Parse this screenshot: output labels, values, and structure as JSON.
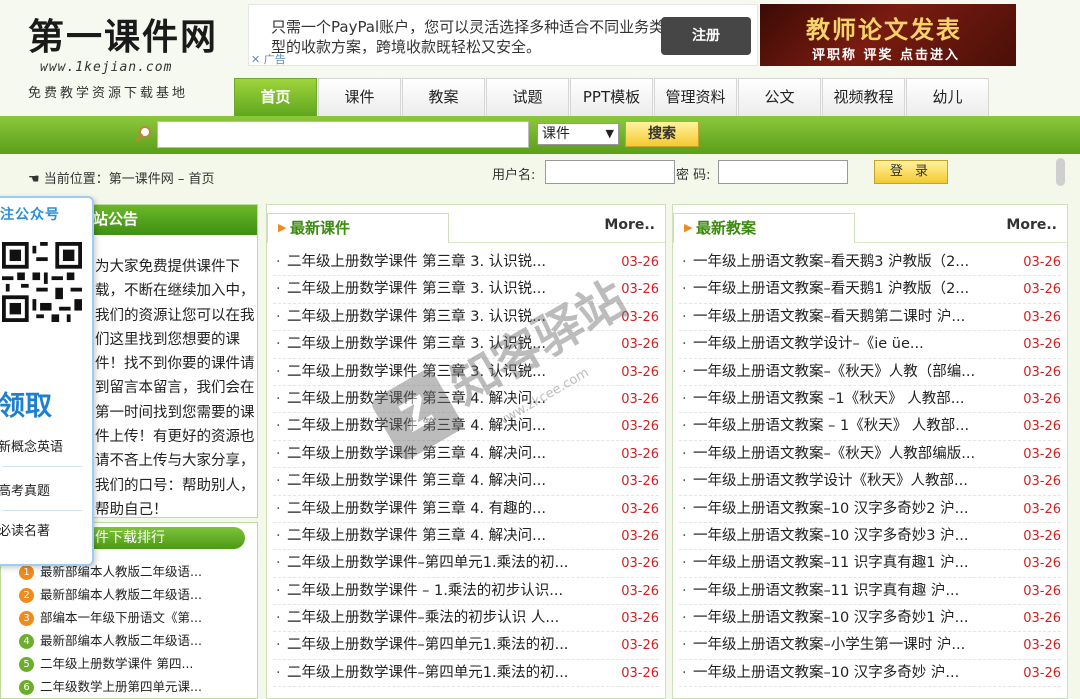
{
  "site": {
    "logo_text": "第一课件网",
    "logo_url": "www.1kejian.com",
    "slogan": "免费教学资源下载基地"
  },
  "ads": {
    "paypal": {
      "text": "只需一个PayPal账户，您可以灵活选择多种适合不同业务类型的收款方案，跨境收款既轻松又安全。",
      "button": "注册",
      "mark": "广告"
    },
    "teacher": {
      "title": "教师论文发表",
      "subtitle": "评职称 评奖 点击进入"
    }
  },
  "nav": {
    "items": [
      "首页",
      "课件",
      "教案",
      "试题",
      "PPT模板",
      "管理资料",
      "公文",
      "视频教程",
      "幼儿"
    ],
    "active": 0
  },
  "search": {
    "placeholder": "",
    "category": "课件",
    "button": "搜索"
  },
  "breadcrumb": "当前位置：第一课件网 – 首页",
  "login": {
    "username_label": "用户名:",
    "password_label": "密 码:",
    "button": "登 录"
  },
  "notice": {
    "title": "站公告",
    "text": "为大家免费提供课件下载，不断在继续加入中，我们的资源让您可以在我们这里找到您想要的课件！找不到你要的课件请到留言本留言，我们会在第一时间找到您需要的课件上传！有更好的资源也请不吝上传与大家分享，我们的口号：帮助别人，帮助自己！"
  },
  "qr_widget": {
    "title": "注公众号",
    "claim": "领取",
    "links": [
      "新概念英语",
      "高考真题",
      "必读名著"
    ]
  },
  "rank": {
    "title": "件下载排行",
    "items": [
      {
        "num": "1",
        "color": "#f08a1c",
        "text": "最新部编本人教版二年级语..."
      },
      {
        "num": "2",
        "color": "#f08a1c",
        "text": "最新部编本人教版二年级语..."
      },
      {
        "num": "3",
        "color": "#f08a1c",
        "text": "部编本一年级下册语文《第..."
      },
      {
        "num": "4",
        "color": "#6aae2a",
        "text": "最新部编本人教版二年级语..."
      },
      {
        "num": "5",
        "color": "#6aae2a",
        "text": "二年级上册数学课件 第四..."
      },
      {
        "num": "6",
        "color": "#6aae2a",
        "text": "二年级数学上册第四单元课..."
      }
    ]
  },
  "panels": {
    "kejian": {
      "title": "最新课件",
      "more": "More..",
      "rows": [
        {
          "title": "二年级上册数学课件 第三章 3. 认识锐...",
          "date": "03-26"
        },
        {
          "title": "二年级上册数学课件 第三章 3. 认识锐...",
          "date": "03-26"
        },
        {
          "title": "二年级上册数学课件 第三章 3. 认识锐...",
          "date": "03-26"
        },
        {
          "title": "二年级上册数学课件 第三章 3. 认识锐...",
          "date": "03-26"
        },
        {
          "title": "二年级上册数学课件 第三章 3. 认识锐...",
          "date": "03-26"
        },
        {
          "title": "二年级上册数学课件 第三章 4. 解决问...",
          "date": "03-26"
        },
        {
          "title": "二年级上册数学课件 第三章 4. 解决问...",
          "date": "03-26"
        },
        {
          "title": "二年级上册数学课件 第三章 4. 解决问...",
          "date": "03-26"
        },
        {
          "title": "二年级上册数学课件 第三章 4. 解决问...",
          "date": "03-26"
        },
        {
          "title": "二年级上册数学课件 第三章 4. 有趣的...",
          "date": "03-26"
        },
        {
          "title": "二年级上册数学课件 第三章 4. 解决问...",
          "date": "03-26"
        },
        {
          "title": "二年级上册数学课件–第四单元1.乘法的初...",
          "date": "03-26"
        },
        {
          "title": "二年级上册数学课件 – 1.乘法的初步认识...",
          "date": "03-26"
        },
        {
          "title": "二年级上册数学课件–乘法的初步认识 人...",
          "date": "03-26"
        },
        {
          "title": "二年级上册数学课件–第四单元1.乘法的初...",
          "date": "03-26"
        },
        {
          "title": "二年级上册数学课件–第四单元1.乘法的初...",
          "date": "03-26"
        }
      ]
    },
    "jiaoan": {
      "title": "最新教案",
      "more": "More..",
      "rows": [
        {
          "title": "一年级上册语文教案–看天鹅3 沪教版（2...",
          "date": "03-26"
        },
        {
          "title": "一年级上册语文教案–看天鹅1 沪教版（2...",
          "date": "03-26"
        },
        {
          "title": "一年级上册语文教案–看天鹅第二课时 沪...",
          "date": "03-26"
        },
        {
          "title": "一年级上册语文教学设计–《ie üe...",
          "date": "03-26"
        },
        {
          "title": "一年级上册语文教案–《秋天》人教（部编...",
          "date": "03-26"
        },
        {
          "title": "一年级上册语文教案 –1《秋天》 人教部...",
          "date": "03-26"
        },
        {
          "title": "一年级上册语文教案 – 1《秋天》 人教部...",
          "date": "03-26"
        },
        {
          "title": "一年级上册语文教案–《秋天》人教部编版...",
          "date": "03-26"
        },
        {
          "title": "一年级上册语文教学设计《秋天》人教部...",
          "date": "03-26"
        },
        {
          "title": "一年级上册语文教案–10 汉字多奇妙2 沪...",
          "date": "03-26"
        },
        {
          "title": "一年级上册语文教案–10 汉字多奇妙3 沪...",
          "date": "03-26"
        },
        {
          "title": "一年级上册语文教案–11 识字真有趣1 沪...",
          "date": "03-26"
        },
        {
          "title": "一年级上册语文教案–11 识字真有趣 沪...",
          "date": "03-26"
        },
        {
          "title": "一年级上册语文教案–10 汉字多奇妙1 沪...",
          "date": "03-26"
        },
        {
          "title": "一年级上册语文教案–小学生第一课时 沪...",
          "date": "03-26"
        },
        {
          "title": "一年级上册语文教案–10 汉字多奇妙 沪...",
          "date": "03-26"
        }
      ]
    }
  },
  "watermark": {
    "text": "知客驿站",
    "domain": "www.zkcee.com"
  }
}
